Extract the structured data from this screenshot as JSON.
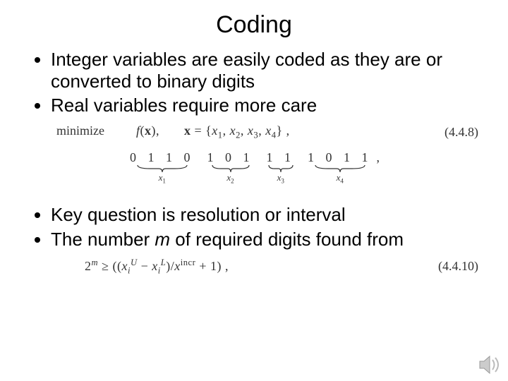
{
  "title": "Coding",
  "bullets_top": [
    "Integer variables are easily coded as they are or converted to binary digits",
    "Real variables require more care"
  ],
  "eq1": {
    "minimize": "minimize",
    "fx": "f(x),",
    "xdef": "x = {x₁, x₂, x₃, x₄} ,",
    "number": "(4.4.8)"
  },
  "brace": {
    "g1": {
      "digits": "0 1 1 0",
      "label": "x₁"
    },
    "g2": {
      "digits": "1 0 1",
      "label": "x₂"
    },
    "g3": {
      "digits": "1 1",
      "label": "x₃"
    },
    "g4": {
      "digits": "1 0 1 1",
      "label": "x₄"
    },
    "trailing": ","
  },
  "bullets_bottom": [
    "Key question is resolution or interval",
    "The number m of required digits found from"
  ],
  "eq2": {
    "body_html": "2<span class='sup'>m</span> ≥ ((x<span class='sub'>i</span><span class='sup'>U</span> − x<span class='sub'>i</span><span class='sup'>L</span>)/x<span class='sup'>incr</span> + 1) ,",
    "number": "(4.4.10)"
  },
  "icons": {
    "audio": "audio-icon"
  }
}
